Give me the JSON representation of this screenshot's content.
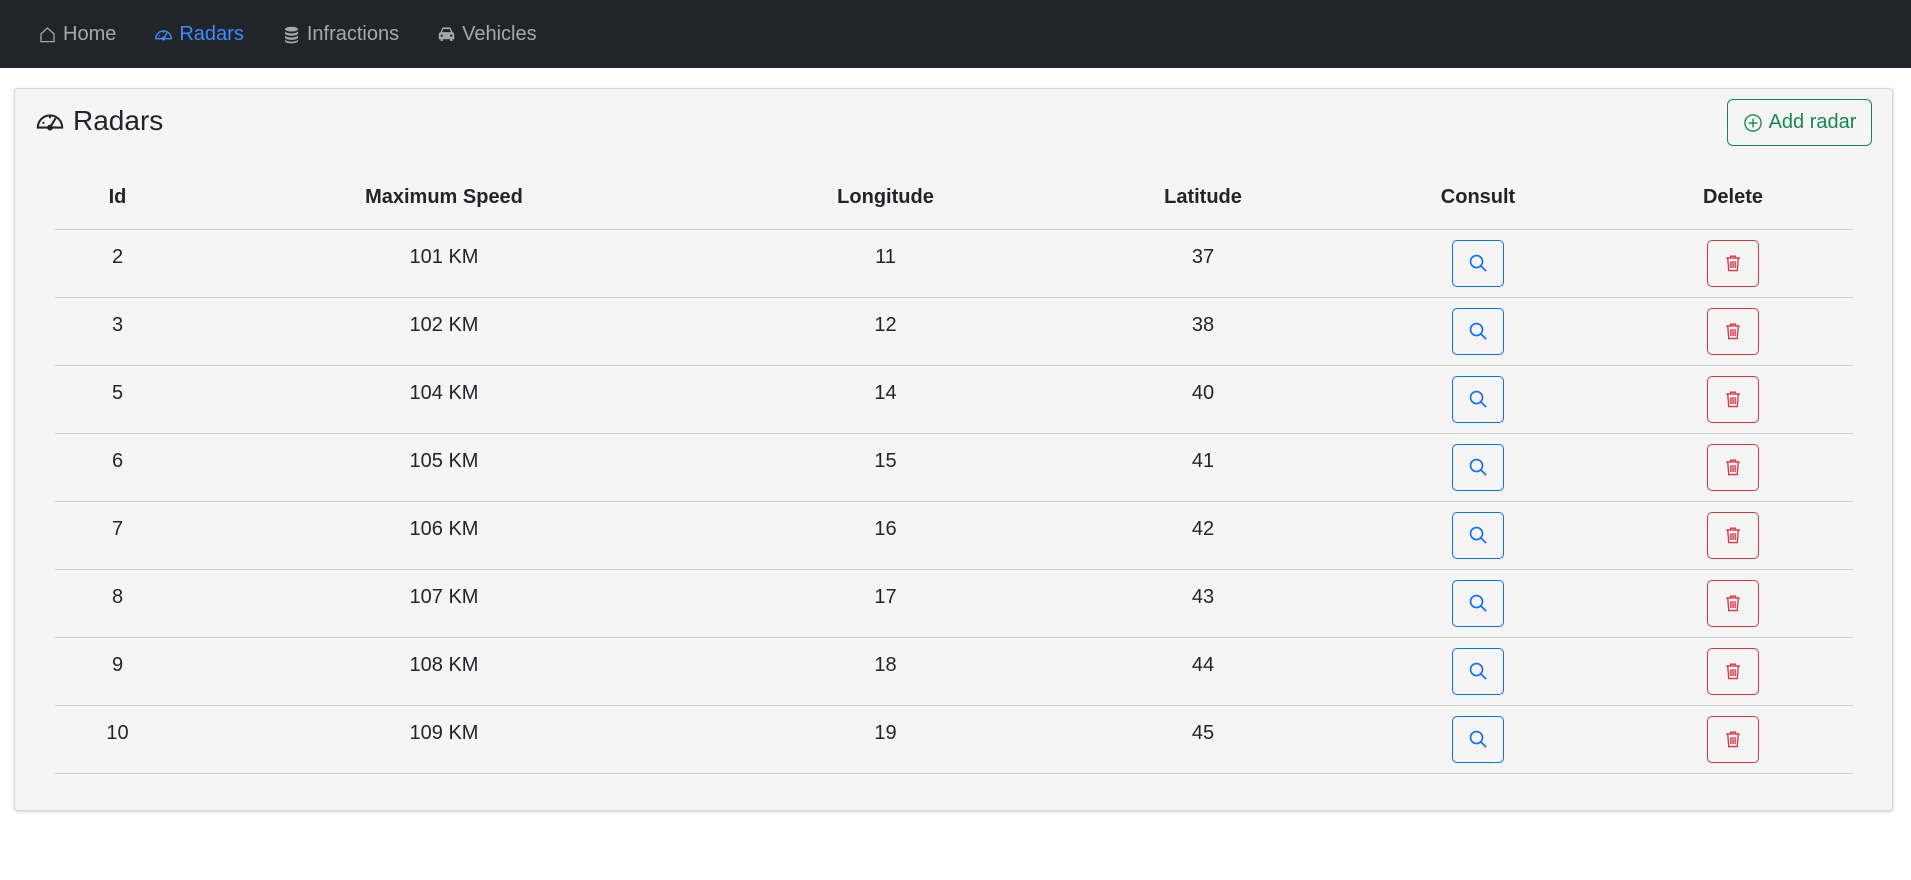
{
  "nav": {
    "items": [
      {
        "label": "Home",
        "icon": "house-icon",
        "active": false
      },
      {
        "label": "Radars",
        "icon": "speedometer-icon",
        "active": true
      },
      {
        "label": "Infractions",
        "icon": "database-icon",
        "active": false
      },
      {
        "label": "Vehicles",
        "icon": "car-icon",
        "active": false
      }
    ]
  },
  "page": {
    "title": "Radars",
    "title_icon": "speedometer-icon",
    "add_button": "Add radar",
    "add_button_icon": "plus-circle-icon"
  },
  "table": {
    "headers": [
      "Id",
      "Maximum Speed",
      "Longitude",
      "Latitude",
      "Consult",
      "Delete"
    ],
    "rows": [
      {
        "id": "2",
        "speed": "101 KM",
        "longitude": "11",
        "latitude": "37"
      },
      {
        "id": "3",
        "speed": "102 KM",
        "longitude": "12",
        "latitude": "38"
      },
      {
        "id": "5",
        "speed": "104 KM",
        "longitude": "14",
        "latitude": "40"
      },
      {
        "id": "6",
        "speed": "105 KM",
        "longitude": "15",
        "latitude": "41"
      },
      {
        "id": "7",
        "speed": "106 KM",
        "longitude": "16",
        "latitude": "42"
      },
      {
        "id": "8",
        "speed": "107 KM",
        "longitude": "17",
        "latitude": "43"
      },
      {
        "id": "9",
        "speed": "108 KM",
        "longitude": "18",
        "latitude": "44"
      },
      {
        "id": "10",
        "speed": "109 KM",
        "longitude": "19",
        "latitude": "45"
      }
    ],
    "consult_icon": "search-icon",
    "delete_icon": "trash-icon"
  },
  "colors": {
    "navbar_bg": "#212529",
    "nav_active": "#3d8bfd",
    "add_button": "#198754",
    "consult_button": "#0d6efd",
    "delete_button": "#dc3545",
    "card_bg": "#f5f5f5"
  }
}
